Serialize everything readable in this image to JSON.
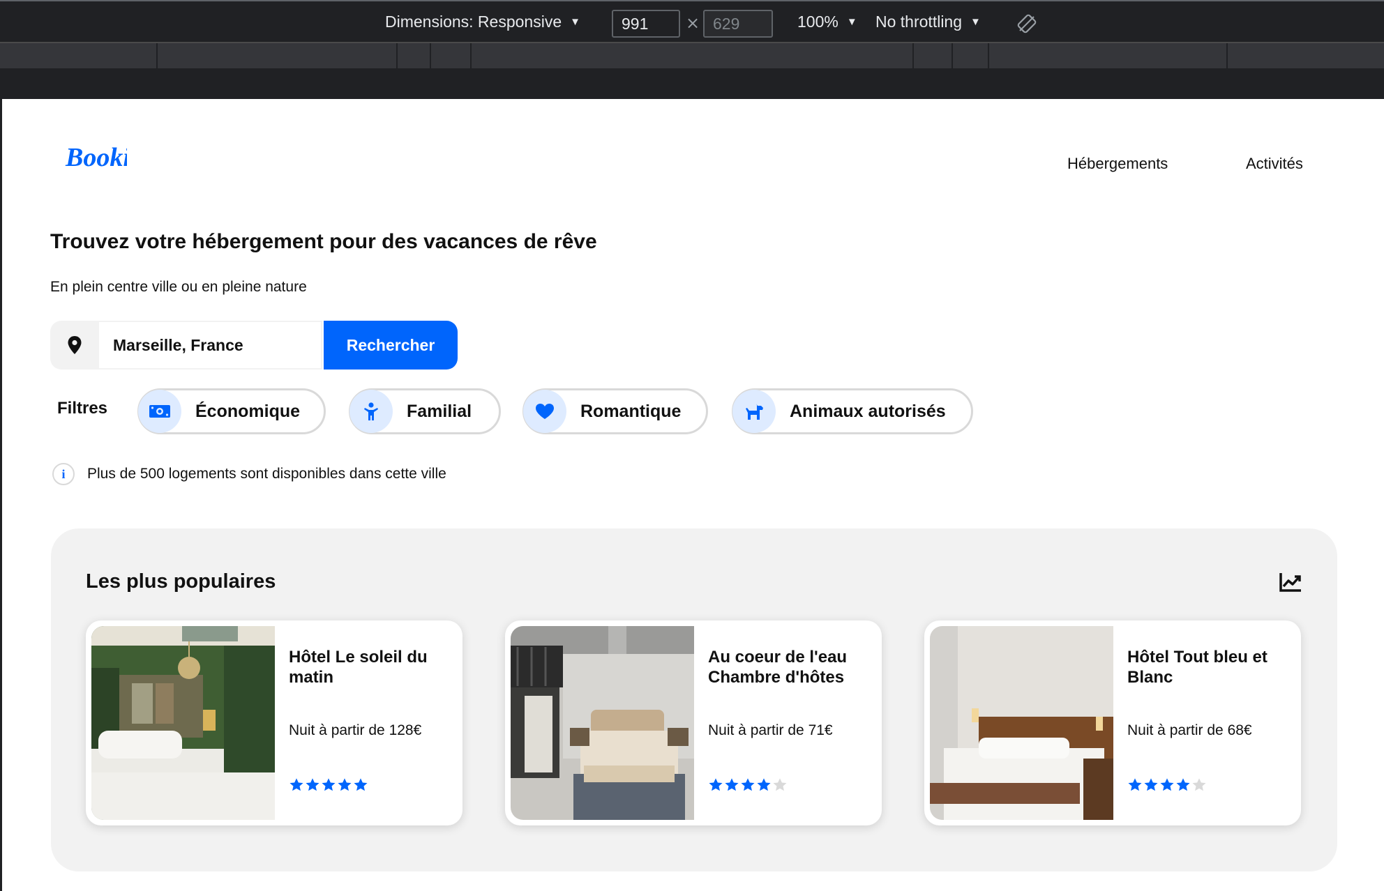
{
  "devtools": {
    "dimensions_label": "Dimensions: Responsive",
    "width_value": "991",
    "height_value": "629",
    "times": "×",
    "zoom": "100%",
    "throttling": "No throttling",
    "caret": "▼"
  },
  "header": {
    "logo": "Booki",
    "nav": [
      "Hébergements",
      "Activités"
    ]
  },
  "hero": {
    "title": "Trouvez votre hébergement pour des vacances de rêve",
    "subtitle": "En plein centre ville ou en pleine nature"
  },
  "search": {
    "value": "Marseille, France",
    "button_label": "Rechercher"
  },
  "filters": {
    "label": "Filtres",
    "items": [
      {
        "label": "Économique",
        "icon": "money-icon"
      },
      {
        "label": "Familial",
        "icon": "child-icon"
      },
      {
        "label": "Romantique",
        "icon": "heart-icon"
      },
      {
        "label": "Animaux autorisés",
        "icon": "dog-icon"
      }
    ]
  },
  "info": {
    "icon_letter": "i",
    "text": "Plus de 500 logements sont disponibles dans cette ville"
  },
  "popular": {
    "title": "Les plus populaires",
    "icon": "chart-line-icon",
    "cards": [
      {
        "name": "Hôtel Le soleil du matin",
        "price": "Nuit à partir de 128€",
        "rating": 5,
        "max_rating": 5
      },
      {
        "name": "Au coeur de l'eau Chambre d'hôtes",
        "price": "Nuit à partir de 71€",
        "rating": 4,
        "max_rating": 5
      },
      {
        "name": "Hôtel Tout bleu et Blanc",
        "price": "Nuit à partir de 68€",
        "rating": 4,
        "max_rating": 5
      }
    ]
  },
  "colors": {
    "accent": "#0065fc",
    "accent_light": "#deebff",
    "star_empty": "#d9d9d9",
    "panel_bg": "#f2f2f2"
  }
}
